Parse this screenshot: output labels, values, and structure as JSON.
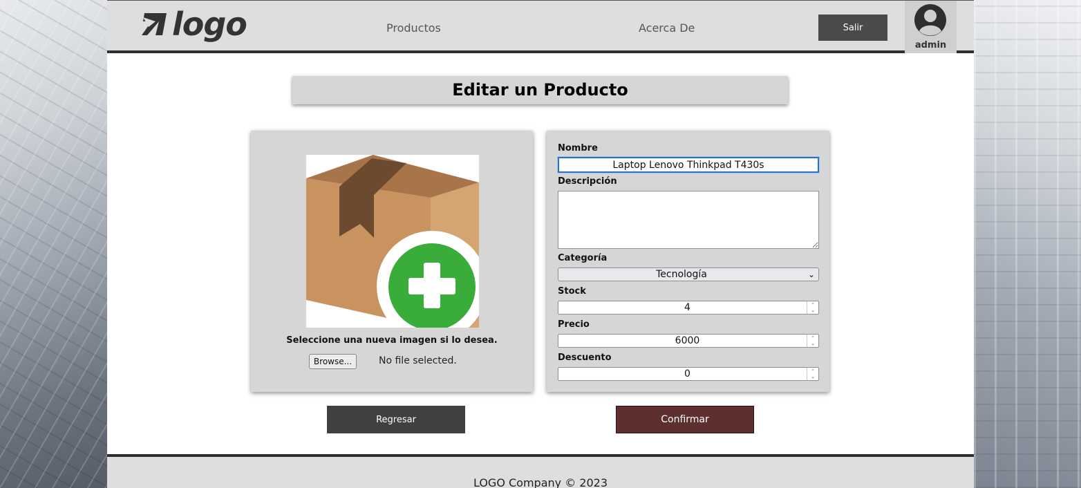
{
  "header": {
    "logo_text": "logo",
    "nav": [
      {
        "label": "Productos"
      },
      {
        "label": "Acerca De"
      }
    ],
    "logout_label": "Salir",
    "username": "admin"
  },
  "main": {
    "title": "Editar un Producto",
    "image_panel": {
      "hint": "Seleccione una nueva imagen si lo desea.",
      "browse_label": "Browse...",
      "file_status": "No file selected."
    },
    "form": {
      "nombre_label": "Nombre",
      "nombre_value": "Laptop Lenovo Thinkpad T430s",
      "descripcion_label": "Descripción",
      "descripcion_value": "",
      "categoria_label": "Categoría",
      "categoria_value": "Tecnología",
      "stock_label": "Stock",
      "stock_value": "4",
      "precio_label": "Precio",
      "precio_value": "6000",
      "descuento_label": "Descuento",
      "descuento_value": "0"
    },
    "back_label": "Regresar",
    "confirm_label": "Confirmar"
  },
  "footer": {
    "text": "LOGO Company © 2023"
  },
  "colors": {
    "confirm_button": "#5e2f2f",
    "back_button": "#404040",
    "focus_outline": "#2a6fc9",
    "plus_green": "#3aac3a",
    "box_brown": "#c8935e"
  }
}
